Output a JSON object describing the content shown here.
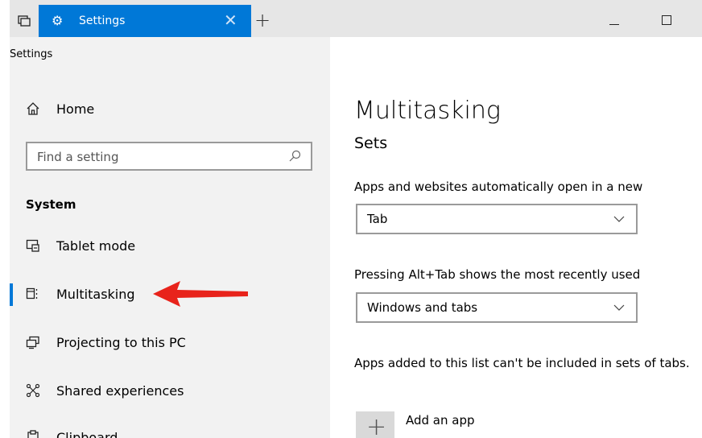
{
  "window": {
    "tab_title": "Settings",
    "tab_close": "✕",
    "new_tab": "+",
    "accent_color": "#0078d7"
  },
  "sidebar": {
    "breadcrumb": "Settings",
    "home_label": "Home",
    "search_placeholder": "Find a setting",
    "section_label": "System",
    "items": [
      {
        "label": "Tablet mode",
        "icon": "tablet-mode-icon"
      },
      {
        "label": "Multitasking",
        "icon": "multitasking-icon",
        "selected": true
      },
      {
        "label": "Projecting to this PC",
        "icon": "projecting-icon"
      },
      {
        "label": "Shared experiences",
        "icon": "shared-experiences-icon"
      },
      {
        "label": "Clipboard",
        "icon": "clipboard-icon"
      }
    ]
  },
  "main": {
    "title": "Multitasking",
    "subtitle": "Sets",
    "open_new_label": "Apps and websites automatically open in a new",
    "open_new_value": "Tab",
    "alt_tab_label": "Pressing Alt+Tab shows the most recently used",
    "alt_tab_value": "Windows and tabs",
    "exclude_label": "Apps added to this list can't be included in sets of tabs.",
    "add_app_label": "Add an app"
  }
}
